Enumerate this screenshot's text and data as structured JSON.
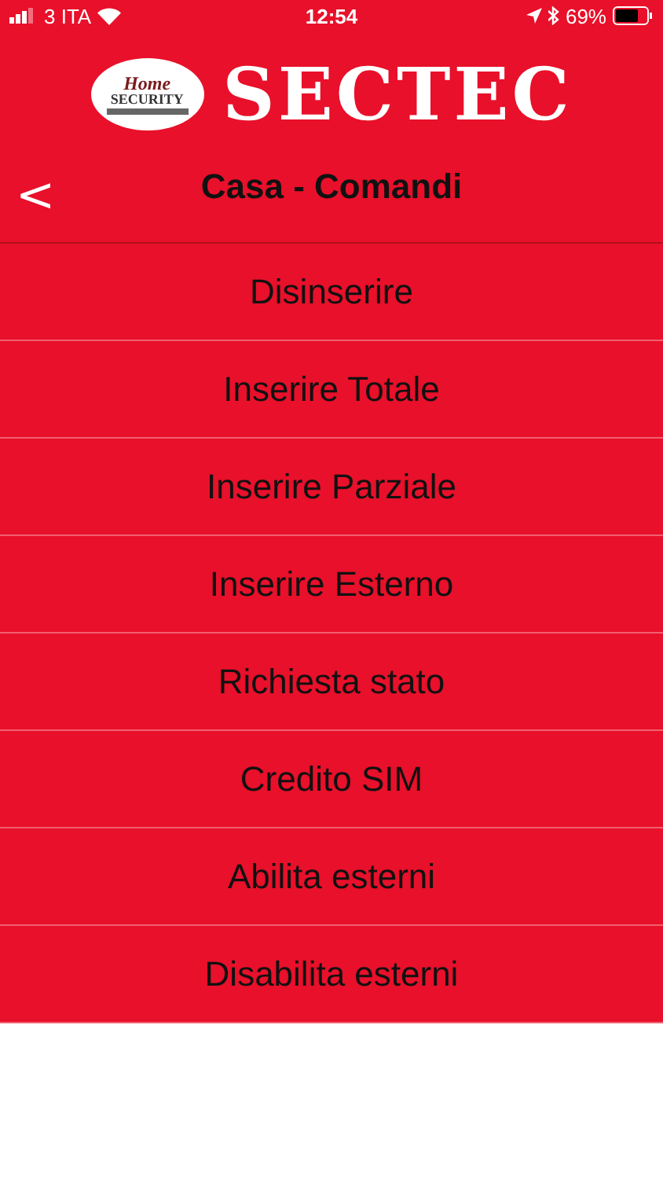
{
  "status_bar": {
    "carrier": "3 ITA",
    "time": "12:54",
    "battery": "69%"
  },
  "logo": {
    "badge_top": "Home",
    "badge_bottom": "SECURITY",
    "brand": "SECTEC"
  },
  "nav": {
    "back": "<",
    "title": "Casa - Comandi"
  },
  "commands": [
    {
      "label": "Disinserire"
    },
    {
      "label": "Inserire Totale"
    },
    {
      "label": "Inserire Parziale"
    },
    {
      "label": "Inserire Esterno"
    },
    {
      "label": "Richiesta stato"
    },
    {
      "label": "Credito SIM"
    },
    {
      "label": "Abilita esterni"
    },
    {
      "label": "Disabilita esterni"
    }
  ]
}
